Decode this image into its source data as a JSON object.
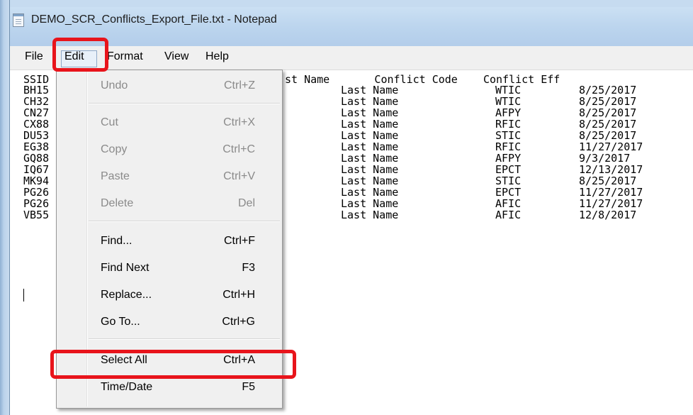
{
  "window": {
    "title": "DEMO_SCR_Conflicts_Export_File.txt - Notepad",
    "icon": "notepad-icon"
  },
  "menubar": {
    "items": [
      "File",
      "Edit",
      "Format",
      "View",
      "Help"
    ]
  },
  "editor": {
    "header": "SSID                 Last Name      Conflict Code    Conflict Eff",
    "header_visible_right": "st Name       Conflict Code    Conflict Eff",
    "header_visible_left": "SSID",
    "rows": [
      {
        "ssid": "BH15",
        "last_name": "Last Name",
        "code": "WTIC",
        "date": "8/25/2017"
      },
      {
        "ssid": "CH32",
        "last_name": "Last Name",
        "code": "WTIC",
        "date": "8/25/2017"
      },
      {
        "ssid": "CN27",
        "last_name": "Last Name",
        "code": "AFPY",
        "date": "8/25/2017"
      },
      {
        "ssid": "CX88",
        "last_name": "Last Name",
        "code": "RFIC",
        "date": "8/25/2017"
      },
      {
        "ssid": "DU53",
        "last_name": "Last Name",
        "code": "STIC",
        "date": "8/25/2017"
      },
      {
        "ssid": "EG38",
        "last_name": "Last Name",
        "code": "RFIC",
        "date": "11/27/2017"
      },
      {
        "ssid": "GQ88",
        "last_name": "Last Name",
        "code": "AFPY",
        "date": "9/3/2017"
      },
      {
        "ssid": "IQ67",
        "last_name": "Last Name",
        "code": "EPCT",
        "date": "12/13/2017"
      },
      {
        "ssid": "MK94",
        "last_name": "Last Name",
        "code": "STIC",
        "date": "8/25/2017"
      },
      {
        "ssid": "PG26",
        "last_name": "Last Name",
        "code": "EPCT",
        "date": "11/27/2017"
      },
      {
        "ssid": "PG26",
        "last_name": "Last Name",
        "code": "AFIC",
        "date": "11/27/2017"
      },
      {
        "ssid": "VB55",
        "last_name": "Last Name",
        "code": "AFIC",
        "date": "12/8/2017"
      }
    ]
  },
  "edit_menu": {
    "items": [
      {
        "label": "Undo",
        "shortcut": "Ctrl+Z",
        "enabled": false
      },
      {
        "label": "Cut",
        "shortcut": "Ctrl+X",
        "enabled": false
      },
      {
        "label": "Copy",
        "shortcut": "Ctrl+C",
        "enabled": false
      },
      {
        "label": "Paste",
        "shortcut": "Ctrl+V",
        "enabled": false
      },
      {
        "label": "Delete",
        "shortcut": "Del",
        "enabled": false
      },
      {
        "label": "Find...",
        "shortcut": "Ctrl+F",
        "enabled": true
      },
      {
        "label": "Find Next",
        "shortcut": "F3",
        "enabled": true
      },
      {
        "label": "Replace...",
        "shortcut": "Ctrl+H",
        "enabled": true
      },
      {
        "label": "Go To...",
        "shortcut": "Ctrl+G",
        "enabled": true
      },
      {
        "label": "Select All",
        "shortcut": "Ctrl+A",
        "enabled": true
      },
      {
        "label": "Time/Date",
        "shortcut": "F5",
        "enabled": true
      }
    ]
  },
  "annotations": {
    "highlight_color": "#e8141b",
    "targets": [
      "Edit",
      "Select All"
    ]
  }
}
